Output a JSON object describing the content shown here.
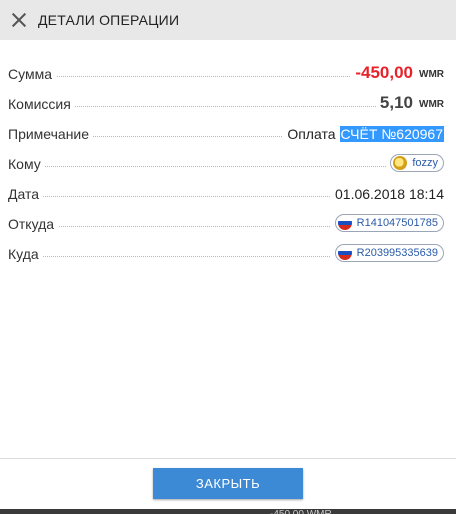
{
  "dialog": {
    "title": "ДЕТАЛИ ОПЕРАЦИИ",
    "close_button_label": "ЗАКРЫТЬ"
  },
  "rows": {
    "amount": {
      "label": "Сумма",
      "value": "-450,00",
      "unit": "WMR",
      "color": "#e8222a"
    },
    "fee": {
      "label": "Комиссия",
      "value": "5,10",
      "unit": "WMR"
    },
    "note": {
      "label": "Примечание",
      "value_prefix": "Оплата",
      "value_selected": "СЧЁТ №620967"
    },
    "to_whom": {
      "label": "Кому",
      "nickname": "fozzy"
    },
    "date": {
      "label": "Дата",
      "value": "01.06.2018 18:14"
    },
    "from": {
      "label": "Откуда",
      "purse": "R141047501785"
    },
    "to": {
      "label": "Куда",
      "purse": "R203995335639"
    }
  },
  "background_hint": "-450,00 WMR",
  "colors": {
    "accent": "#3c8ad6",
    "negative": "#e8222a",
    "selection": "#3399ff"
  }
}
